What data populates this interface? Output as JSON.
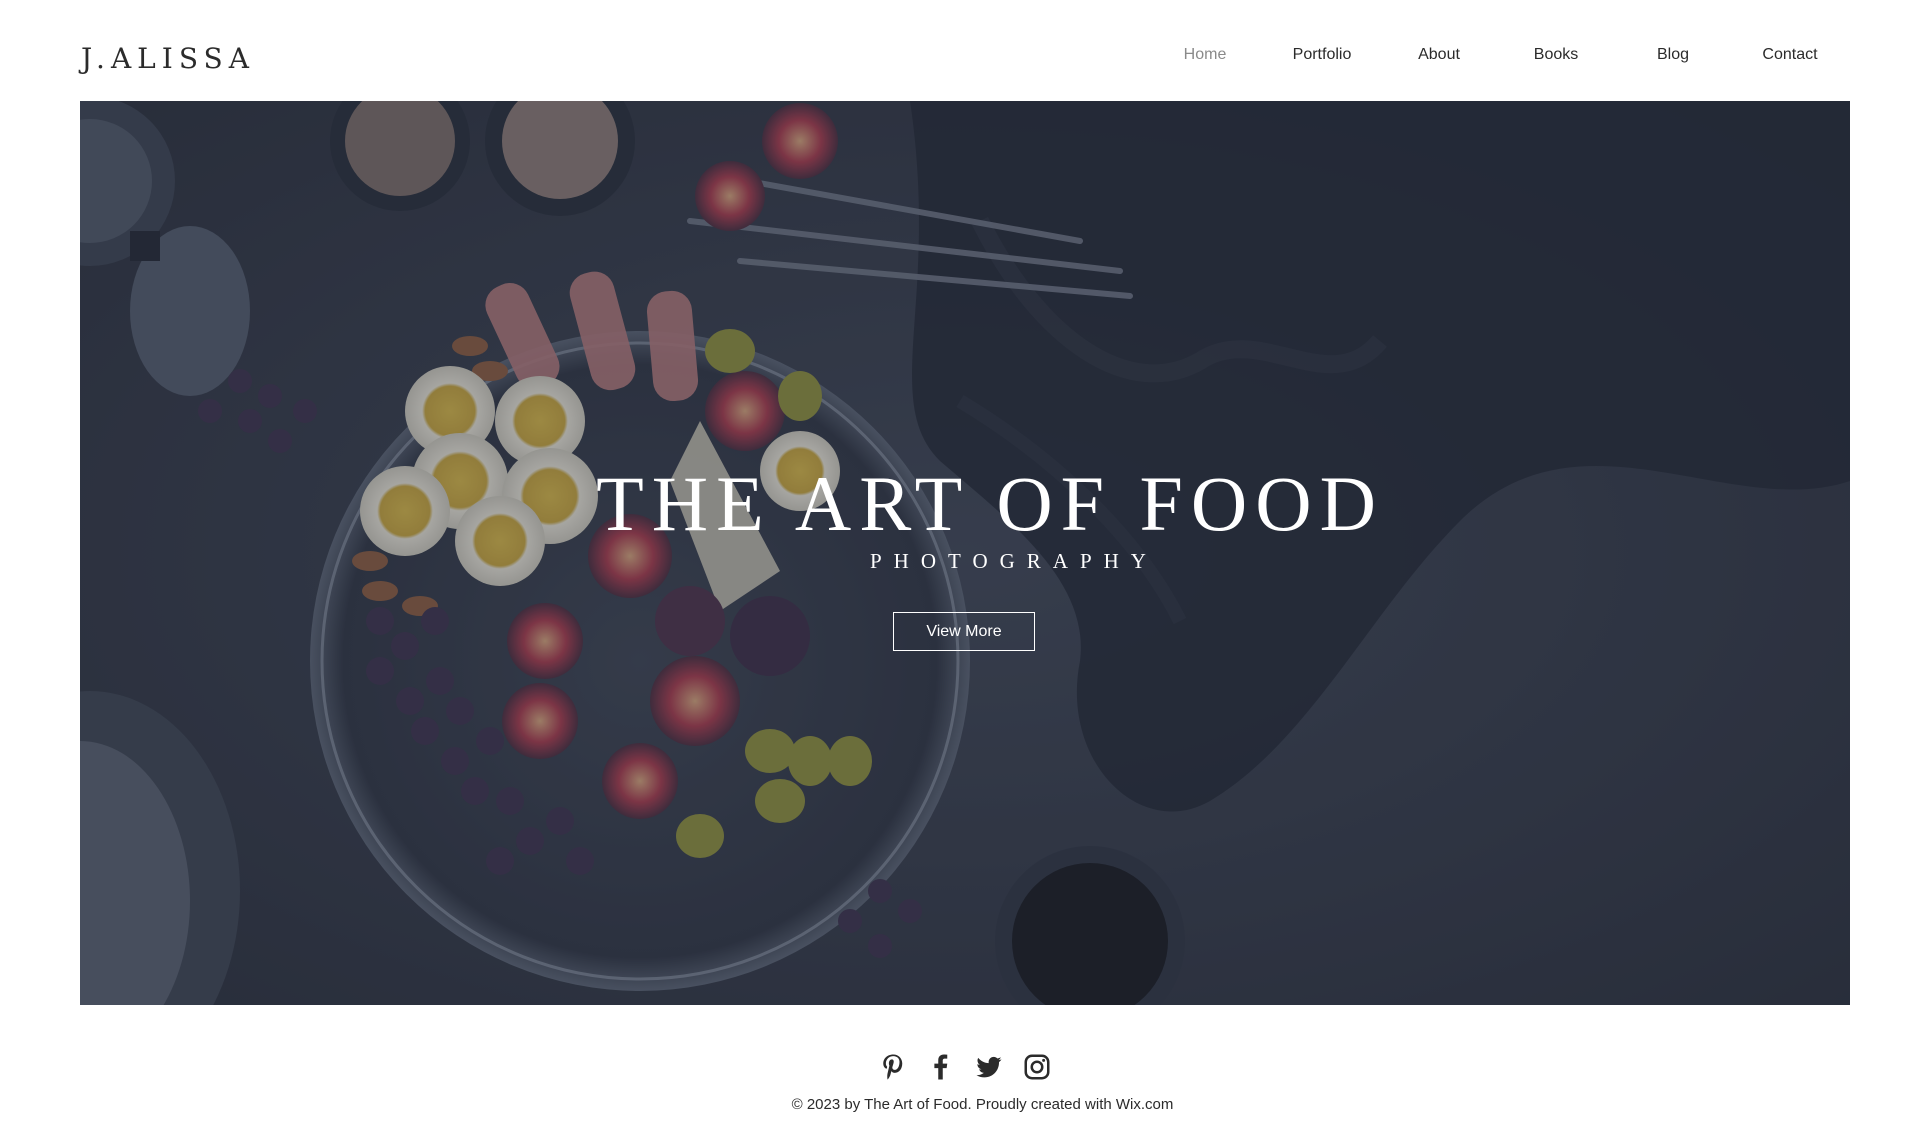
{
  "header": {
    "logo": "J.ALISSA",
    "nav": [
      {
        "label": "Home",
        "active": true
      },
      {
        "label": "Portfolio",
        "active": false
      },
      {
        "label": "About",
        "active": false
      },
      {
        "label": "Books",
        "active": false
      },
      {
        "label": "Blog",
        "active": false
      },
      {
        "label": "Contact",
        "active": false
      }
    ]
  },
  "hero": {
    "title": "THE ART OF FOOD",
    "subtitle": "PHOTOGRAPHY",
    "button_label": "View More"
  },
  "footer": {
    "social_icons": [
      "pinterest-icon",
      "facebook-icon",
      "twitter-icon",
      "instagram-icon"
    ],
    "copyright_prefix": "© 2023 by The Art of Food. Proudly created with ",
    "copyright_link": "Wix.com"
  },
  "colors": {
    "text": "#2b2b2b",
    "active_nav": "#8a8a8a",
    "hero_overlay": "#2a3140",
    "hero_text": "#ffffff"
  }
}
